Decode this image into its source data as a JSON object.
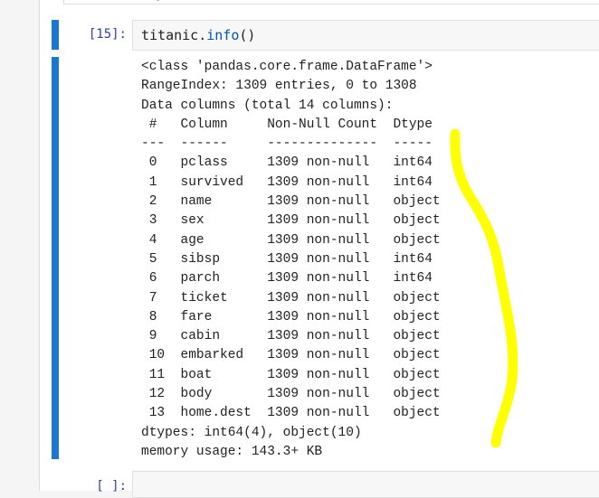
{
  "cells": [
    {
      "prompt": "[15]:",
      "input_object": "titanic",
      "input_dot": ".",
      "input_method": "info",
      "input_parens": "()",
      "output_lines": [
        "<class 'pandas.core.frame.DataFrame'>",
        "RangeIndex: 1309 entries, 0 to 1308",
        "Data columns (total 14 columns):",
        " #   Column     Non-Null Count  Dtype ",
        "---  ------     --------------  ----- ",
        " 0   pclass     1309 non-null   int64 ",
        " 1   survived   1309 non-null   int64 ",
        " 2   name       1309 non-null   object",
        " 3   sex        1309 non-null   object",
        " 4   age        1309 non-null   object",
        " 5   sibsp      1309 non-null   int64 ",
        " 6   parch      1309 non-null   int64 ",
        " 7   ticket     1309 non-null   object",
        " 8   fare       1309 non-null   object",
        " 9   cabin      1309 non-null   object",
        " 10  embarked   1309 non-null   object",
        " 11  boat       1309 non-null   object",
        " 12  body       1309 non-null   object",
        " 13  home.dest  1309 non-null   object",
        "dtypes: int64(4), object(10)",
        "memory usage: 143.3+ KB"
      ]
    },
    {
      "prompt": "[ ]:"
    }
  ],
  "colors": {
    "active_cell_bar": "#1976d2",
    "prompt": "#303f9f",
    "highlight_scribble": "#ffff00"
  }
}
